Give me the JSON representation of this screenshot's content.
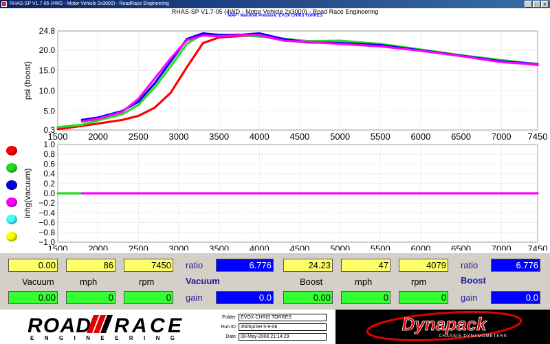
{
  "window": {
    "title": "RHAS-SP V1.7-05  (4WD - Motor Vehicle 2x3000) - RoadRace Engineering"
  },
  "header": {
    "title": "RHAS-SP V1.7-05   (4WD - Motor Vehicle 2x3000) - Road Race Engineering",
    "subtitle": "MAP - Manifold Pressure: EVOX CHRIS TORRES"
  },
  "colors": {
    "red": "#ff0000",
    "green": "#22dd22",
    "blue": "#0000ee",
    "magenta": "#ff00ff",
    "cyan": "#44ffff",
    "yellow": "#ffff00"
  },
  "legend_dots": [
    "red",
    "green",
    "blue",
    "magenta",
    "cyan",
    "yellow"
  ],
  "chart_data": [
    {
      "type": "line",
      "ylabel": "psi (boost)",
      "xlim": [
        1500,
        7450
      ],
      "ylim": [
        0.3,
        24.8
      ],
      "xticks": [
        1500,
        2000,
        2500,
        3000,
        3500,
        4000,
        4500,
        5000,
        5500,
        6000,
        6500,
        7000,
        7450
      ],
      "yticks": [
        0.3,
        5.0,
        10.0,
        15.0,
        20.0,
        24.8
      ],
      "ytick_labels": [
        "0.3",
        "5.0",
        "10.0",
        "15.0",
        "20.0",
        "24.8"
      ],
      "series": [
        {
          "color": "#ff0000",
          "x": [
            1500,
            1800,
            2000,
            2300,
            2500,
            2700,
            2900,
            3100,
            3300,
            3500,
            3800,
            4000,
            4300,
            4600,
            5000,
            5500,
            6000,
            6500,
            7000,
            7450
          ],
          "y": [
            0.5,
            1.3,
            1.9,
            2.8,
            3.8,
            5.8,
            9.5,
            15.8,
            21.8,
            23.2,
            23.6,
            23.6,
            22.5,
            22.0,
            21.8,
            21.3,
            20.0,
            18.6,
            17.3,
            16.4
          ]
        },
        {
          "color": "#22dd22",
          "x": [
            1500,
            1800,
            2000,
            2300,
            2500,
            2700,
            2900,
            3100,
            3300,
            3500,
            3800,
            4000,
            4300,
            4600,
            5000,
            5500,
            6000,
            6500,
            7000,
            7450
          ],
          "y": [
            1.0,
            1.6,
            2.7,
            4.2,
            6.5,
            10.8,
            16.0,
            21.6,
            24.0,
            23.9,
            23.7,
            23.4,
            22.9,
            22.3,
            22.4,
            21.6,
            20.2,
            18.8,
            17.6,
            16.6
          ]
        },
        {
          "color": "#0000ee",
          "x": [
            1800,
            2000,
            2300,
            2500,
            2700,
            2900,
            3100,
            3300,
            3500,
            3800,
            4000,
            4300,
            4600,
            5000,
            5500,
            6000,
            6500,
            7000,
            7450
          ],
          "y": [
            2.8,
            3.4,
            5.0,
            7.3,
            11.8,
            17.2,
            22.8,
            24.2,
            23.8,
            23.9,
            24.2,
            22.8,
            22.0,
            21.8,
            21.3,
            20.0,
            18.7,
            17.3,
            16.6
          ]
        },
        {
          "color": "#ff00ff",
          "x": [
            1800,
            2000,
            2300,
            2500,
            2700,
            2900,
            3100,
            3300,
            3500,
            3800,
            4000,
            4300,
            4600,
            5000,
            5500,
            6000,
            6500,
            7000,
            7450
          ],
          "y": [
            2.4,
            3.1,
            4.8,
            8.0,
            13.0,
            18.0,
            22.5,
            23.7,
            23.5,
            23.8,
            23.8,
            22.4,
            22.1,
            21.6,
            21.0,
            19.9,
            18.6,
            17.1,
            16.5
          ]
        }
      ]
    },
    {
      "type": "line",
      "ylabel": "inhg(vacuum)",
      "xlim": [
        1500,
        7450
      ],
      "ylim": [
        -1.0,
        1.0
      ],
      "xticks": [
        1500,
        2000,
        2500,
        3000,
        3500,
        4000,
        4500,
        5000,
        5500,
        6000,
        6500,
        7000,
        7450
      ],
      "yticks": [
        1.0,
        0.8,
        0.6,
        0.4,
        0.2,
        0.0,
        -0.2,
        -0.4,
        -0.6,
        -0.8,
        -1.0
      ],
      "ytick_labels": [
        "1.0",
        "0.8",
        "0.6",
        "0.4",
        "0.2",
        "0.0",
        "−0.2",
        "−0.4",
        "−0.6",
        "−0.8",
        "−1.0"
      ],
      "series": [
        {
          "color": "#22dd22",
          "x": [
            1500,
            1800
          ],
          "y": [
            0.0,
            0.0
          ]
        },
        {
          "color": "#ff00ff",
          "x": [
            1800,
            7450
          ],
          "y": [
            0.0,
            0.0
          ]
        }
      ]
    }
  ],
  "readouts": {
    "left": {
      "vacuum_value": "0.00",
      "mph_value": "86",
      "rpm_value": "7450",
      "ratio_label": "ratio",
      "ratio_value": "6.776",
      "vacuum_label": "Vacuum",
      "mph_label": "mph",
      "rpm_label": "rpm",
      "section_label": "Vacuum",
      "vacuum2": "0.00",
      "mph2": "0",
      "rpm2": "0",
      "gain_label": "gain",
      "gain_value": "0.0"
    },
    "right": {
      "boost_value": "24.23",
      "mph_value": "47",
      "rpm_value": "4079",
      "ratio_label": "ratio",
      "ratio_value": "6.776",
      "boost_label": "Boost",
      "mph_label": "mph",
      "rpm_label": "rpm",
      "section_label": "Boost",
      "boost2": "0.00",
      "mph2": "0",
      "rpm2": "0",
      "gain_label": "gain",
      "gain_value": "0.0"
    }
  },
  "footer": {
    "logo_road": "ROAD",
    "logo_race": "RACE",
    "logo_tagline": "ENGINEERING",
    "folder_label": "Folder",
    "folder_value": "EVOX CHRIS TORRES",
    "runid_label": "Run ID",
    "runid_value": "350hpISH 5-9-08",
    "date_label": "Date",
    "date_value": "08-May-2008  21:14:29",
    "dyna_logo": "Dynapack",
    "dyna_tagline": "CHASSIS DYNAMOMETERS"
  }
}
